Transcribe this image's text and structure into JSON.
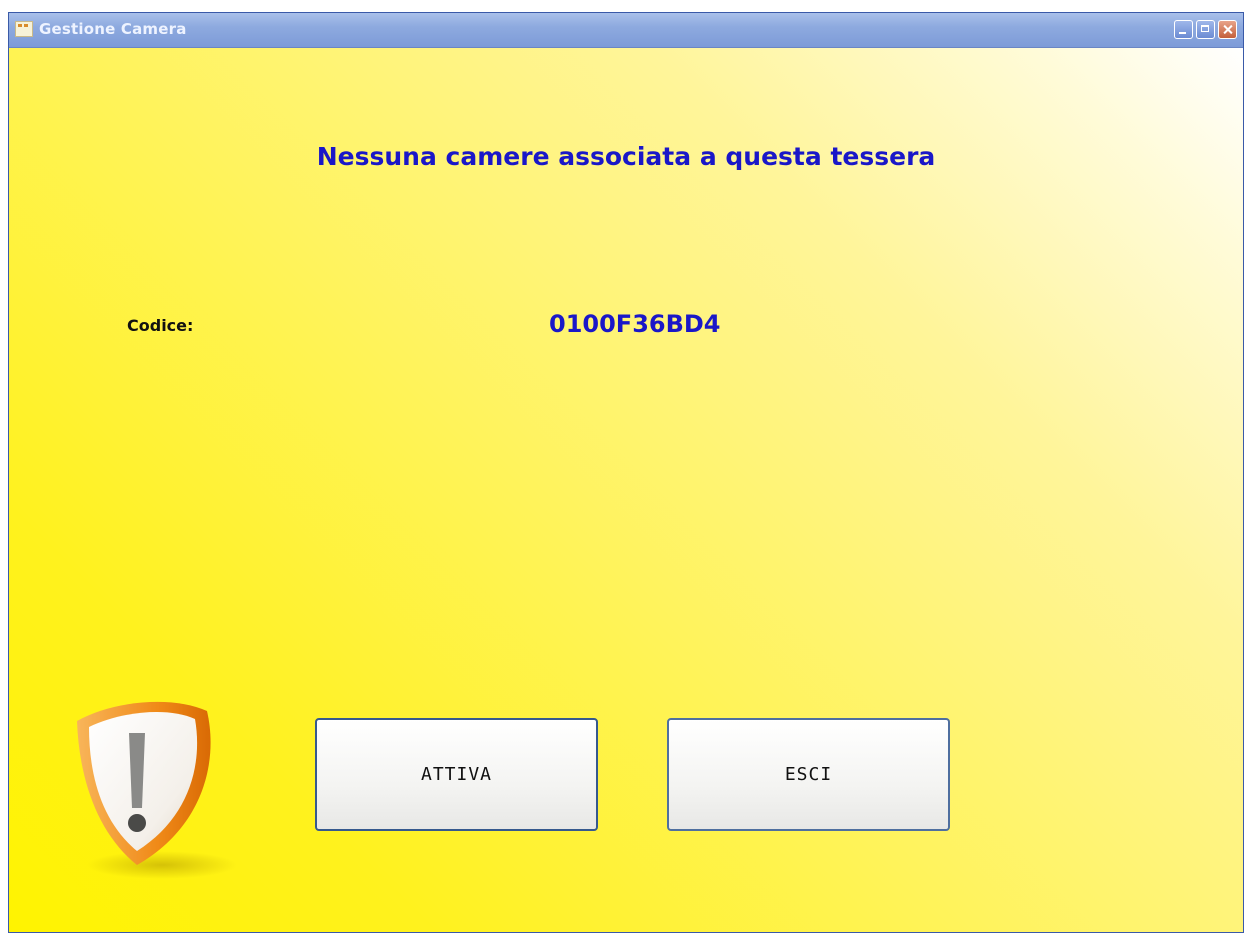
{
  "window": {
    "title": "Gestione Camera",
    "controls": [
      "minimize-icon",
      "maximize-icon",
      "close-icon"
    ]
  },
  "main": {
    "message": "Nessuna camere associata a questa tessera",
    "codice_label": "Codice:",
    "codice_value": "0100F36BD4"
  },
  "buttons": {
    "attiva_label": "ATTIVA",
    "esci_label": "ESCI"
  },
  "icons": {
    "warning": "warning-shield-icon"
  },
  "colors": {
    "message_text": "#1a17c8",
    "background": "#fff300",
    "shield_orange": "#f07d12"
  }
}
